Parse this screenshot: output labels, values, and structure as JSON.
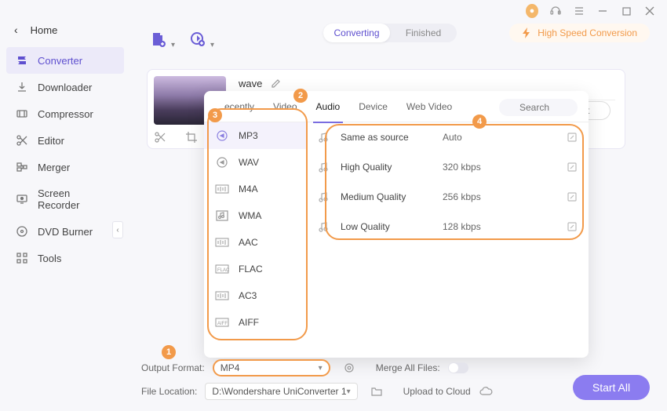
{
  "header": {
    "home_label": "Home"
  },
  "sidebar": {
    "items": [
      {
        "label": "Converter"
      },
      {
        "label": "Downloader"
      },
      {
        "label": "Compressor"
      },
      {
        "label": "Editor"
      },
      {
        "label": "Merger"
      },
      {
        "label": "Screen Recorder"
      },
      {
        "label": "DVD Burner"
      },
      {
        "label": "Tools"
      }
    ]
  },
  "segmented": {
    "converting": "Converting",
    "finished": "Finished"
  },
  "hs_label": "High Speed Conversion",
  "file": {
    "name": "wave"
  },
  "convert_btn": "nvert",
  "popover": {
    "tabs": {
      "recently": "ecently",
      "video": "Video",
      "audio": "Audio",
      "device": "Device",
      "webvideo": "Web Video"
    },
    "search_placeholder": "Search",
    "formats": [
      {
        "label": "MP3"
      },
      {
        "label": "WAV"
      },
      {
        "label": "M4A"
      },
      {
        "label": "WMA"
      },
      {
        "label": "AAC"
      },
      {
        "label": "FLAC"
      },
      {
        "label": "AC3"
      },
      {
        "label": "AIFF"
      }
    ],
    "qualities": [
      {
        "name": "Same as source",
        "val": "Auto"
      },
      {
        "name": "High Quality",
        "val": "320 kbps"
      },
      {
        "name": "Medium Quality",
        "val": "256 kbps"
      },
      {
        "name": "Low Quality",
        "val": "128 kbps"
      }
    ]
  },
  "callouts": {
    "b1": "1",
    "b2": "2",
    "b3": "3",
    "b4": "4"
  },
  "bottom": {
    "output_format_label": "Output Format:",
    "output_format_value": "MP4",
    "file_location_label": "File Location:",
    "file_location_value": "D:\\Wondershare UniConverter 1",
    "merge_label": "Merge All Files:",
    "upload_label": "Upload to Cloud",
    "start_all": "Start All"
  }
}
